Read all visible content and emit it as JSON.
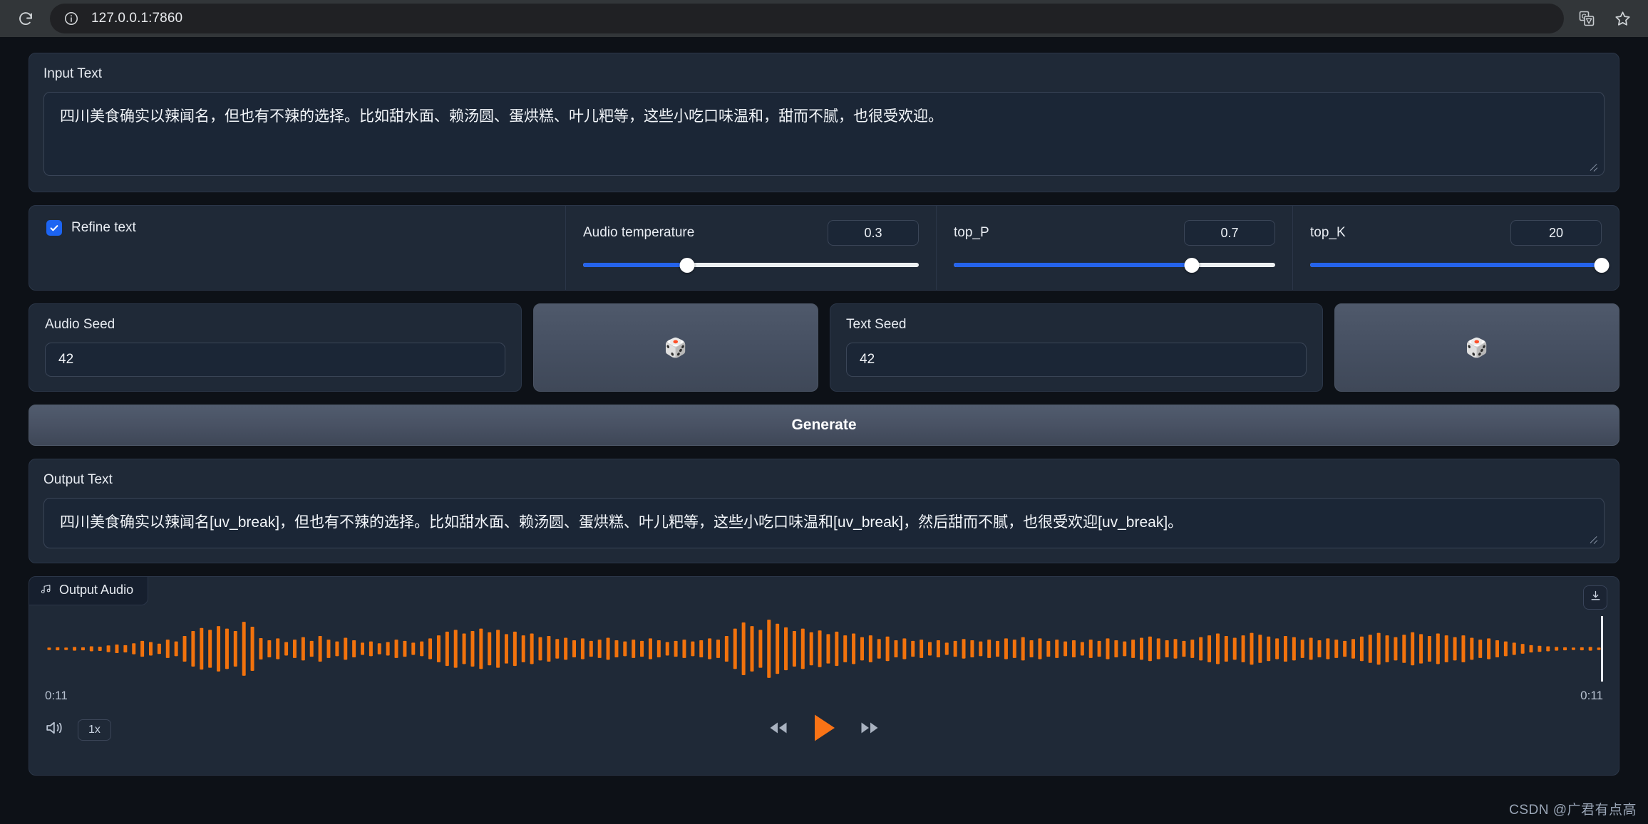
{
  "browser": {
    "reload_icon": "reload-icon",
    "site_info_icon": "site-info-icon",
    "url": "127.0.0.1:7860",
    "translate_icon": "translate-icon",
    "bookmark_icon": "bookmark-star-icon"
  },
  "input_section": {
    "label": "Input Text",
    "value": "四川美食确实以辣闻名，但也有不辣的选择。比如甜水面、赖汤圆、蛋烘糕、叶儿粑等，这些小吃口味温和，甜而不腻，也很受欢迎。",
    "placeholder": ""
  },
  "controls": {
    "refine": {
      "label": "Refine text",
      "checked": true
    },
    "sliders": [
      {
        "label": "Audio temperature",
        "value": "0.3",
        "percent": 31
      },
      {
        "label": "top_P",
        "value": "0.7",
        "percent": 74
      },
      {
        "label": "top_K",
        "value": "20",
        "percent": 100
      }
    ]
  },
  "seeds": {
    "audio": {
      "label": "Audio Seed",
      "value": "42"
    },
    "text": {
      "label": "Text Seed",
      "value": "42"
    },
    "dice_icon": "dice-icon",
    "dice_glyph": "🎲"
  },
  "generate": {
    "label": "Generate"
  },
  "output_section": {
    "label": "Output Text",
    "value": "四川美食确实以辣闻名[uv_break]，但也有不辣的选择。比如甜水面、赖汤圆、蛋烘糕、叶儿粑等，这些小吃口味温和[uv_break]，然后甜而不腻，也很受欢迎[uv_break]。"
  },
  "audio": {
    "tab_label": "Output Audio",
    "music_icon": "music-note-icon",
    "download_icon": "download-icon",
    "time_current": "0:11",
    "time_total": "0:11",
    "volume_icon": "volume-icon",
    "speed_label": "1x",
    "rewind_icon": "rewind-icon",
    "play_icon": "play-icon",
    "forward_icon": "fast-forward-icon",
    "waveform_color": "#f2720c",
    "play_color": "#f97316",
    "waveform_peaks": [
      0.04,
      0.05,
      0.04,
      0.06,
      0.05,
      0.08,
      0.07,
      0.11,
      0.14,
      0.12,
      0.18,
      0.26,
      0.22,
      0.17,
      0.3,
      0.24,
      0.42,
      0.58,
      0.68,
      0.62,
      0.74,
      0.66,
      0.58,
      0.88,
      0.72,
      0.35,
      0.28,
      0.34,
      0.22,
      0.3,
      0.38,
      0.26,
      0.42,
      0.3,
      0.24,
      0.36,
      0.28,
      0.2,
      0.24,
      0.18,
      0.22,
      0.3,
      0.26,
      0.2,
      0.24,
      0.34,
      0.44,
      0.56,
      0.62,
      0.5,
      0.58,
      0.66,
      0.54,
      0.62,
      0.48,
      0.56,
      0.44,
      0.5,
      0.38,
      0.42,
      0.32,
      0.36,
      0.28,
      0.34,
      0.26,
      0.3,
      0.36,
      0.28,
      0.24,
      0.3,
      0.26,
      0.34,
      0.28,
      0.22,
      0.26,
      0.3,
      0.24,
      0.28,
      0.34,
      0.3,
      0.42,
      0.66,
      0.86,
      0.74,
      0.62,
      0.95,
      0.82,
      0.7,
      0.58,
      0.66,
      0.54,
      0.6,
      0.48,
      0.56,
      0.44,
      0.5,
      0.38,
      0.44,
      0.32,
      0.4,
      0.28,
      0.34,
      0.26,
      0.3,
      0.22,
      0.28,
      0.2,
      0.26,
      0.32,
      0.28,
      0.24,
      0.3,
      0.26,
      0.34,
      0.3,
      0.38,
      0.28,
      0.34,
      0.26,
      0.3,
      0.24,
      0.28,
      0.22,
      0.3,
      0.26,
      0.34,
      0.28,
      0.24,
      0.3,
      0.36,
      0.4,
      0.34,
      0.28,
      0.32,
      0.26,
      0.3,
      0.38,
      0.44,
      0.5,
      0.42,
      0.36,
      0.44,
      0.52,
      0.46,
      0.4,
      0.34,
      0.42,
      0.38,
      0.3,
      0.36,
      0.28,
      0.34,
      0.3,
      0.26,
      0.32,
      0.4,
      0.46,
      0.52,
      0.44,
      0.38,
      0.46,
      0.54,
      0.48,
      0.42,
      0.5,
      0.44,
      0.38,
      0.44,
      0.36,
      0.3,
      0.34,
      0.28,
      0.24,
      0.2,
      0.16,
      0.12,
      0.1,
      0.08,
      0.06,
      0.05,
      0.04,
      0.05,
      0.06,
      0.04
    ]
  },
  "watermark": "CSDN @广君有点高"
}
